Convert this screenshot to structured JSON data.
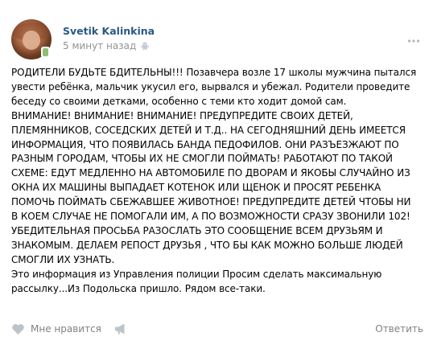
{
  "post": {
    "author": "Svetik Kalinkina",
    "time": "5 минут назад",
    "text_lines": [
      "РОДИТЕЛИ БУДЬТЕ БДИТЕЛЬНЫ!!! Позавчера возле 17 школы мужчина пытался",
      "увести ребёнка, мальчик укусил его, вырвался и убежал. Родители проведите",
      "беседу со своими детками, особенно с теми кто ходит домой сам.",
      "ВНИМАНИЕ! ВНИМАНИЕ! ВНИМАНИЕ! ПРЕДУПРЕДИТЕ СВОИХ ДЕТЕЙ,",
      "ПЛЕМЯННИКОВ, СОСЕДСКИХ ДЕТЕЙ И Т.Д.. НА СЕГОДНЯШНИЙ ДЕНЬ ИМЕЕТСЯ",
      "ИНФОРМАЦИЯ, ЧТО ПОЯВИЛАСЬ БАНДА ПЕДОФИЛОВ. ОНИ РАЗЪЕЗЖАЮТ ПО",
      "РАЗНЫМ ГОРОДАМ, ЧТОБЫ ИХ НЕ СМОГЛИ ПОЙМАТЬ! РАБОТАЮТ ПО ТАКОЙ",
      "СХЕМЕ: ЕДУТ МЕДЛЕННО НА АВТОМОБИЛЕ ПО ДВОРАМ И ЯКОБЫ СЛУЧАЙНО ИЗ",
      "ОКНА ИХ МАШИНЫ ВЫПАДАЕТ КОТЕНОК ИЛИ ЩЕНОК И ПРОСЯТ РЕБЕНКА",
      "ПОМОЧЬ ПОЙМАТЬ СБЕЖАВШЕЕ ЖИВОТНОЕ! ПРЕДУПРЕДИТЕ ДЕТЕЙ ЧТОБЫ НИ",
      "В КОЕМ СЛУЧАЕ НЕ ПОМОГАЛИ ИМ, А ПО ВОЗМОЖНОСТИ СРАЗУ ЗВОНИЛИ 102!",
      "УБЕДИТЕЛЬНАЯ ПРОСЬБА РАЗОСЛАТЬ ЭТО СООБЩЕНИЕ ВСЕМ ДРУЗЬЯМ И",
      "ЗНАКОМЫМ. ДЕЛАЕМ РЕПОСТ ДРУЗЬЯ , ЧТО БЫ КАК МОЖНО БОЛЬШЕ ЛЮДЕЙ",
      "СМОГЛИ ИХ УЗНАТЬ.",
      "Это информация из Управления полиции Просим сделать максимальную",
      "рассылку...Из Подольска пришло. Рядом все-таки."
    ]
  },
  "footer": {
    "like_label": "Мне нравится",
    "reply_label": "Ответить"
  },
  "icons": {
    "platform": "android-icon",
    "menu": "more-dots-icon",
    "like": "heart-icon",
    "share": "megaphone-icon",
    "online": "mobile-online-icon"
  },
  "colors": {
    "author_link": "#2a5885",
    "secondary_text": "#939393",
    "action_text": "#828282",
    "online_badge": "#8ac176",
    "icon_gray": "#bdc3cb"
  }
}
